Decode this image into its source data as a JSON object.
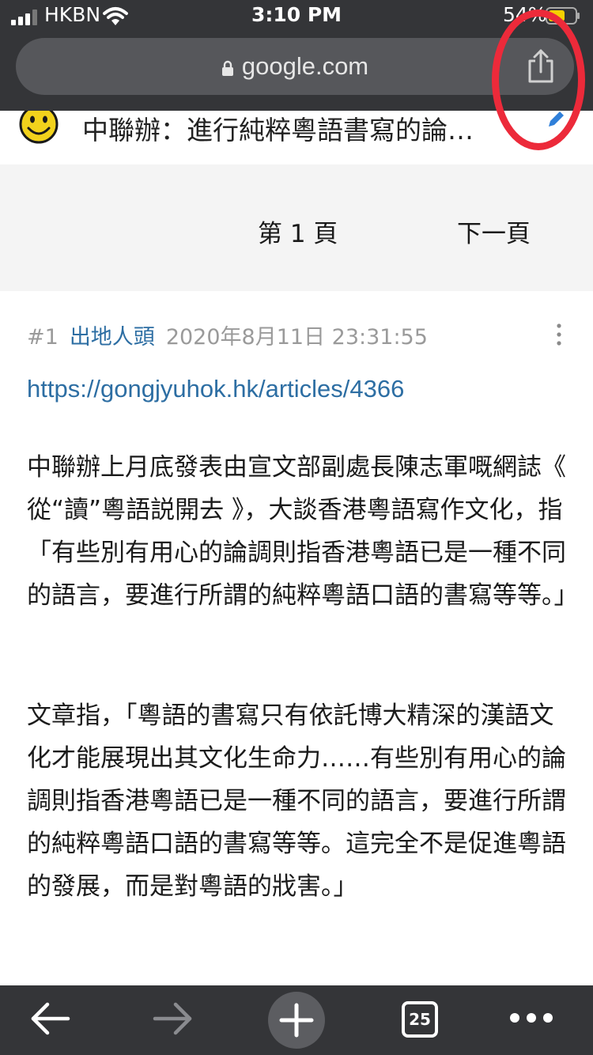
{
  "status_bar": {
    "carrier": "HKBN",
    "time": "3:10 PM",
    "battery_text": "54%"
  },
  "browser": {
    "url": "google.com",
    "icons": [
      "lock-icon",
      "share-icon"
    ]
  },
  "page": {
    "title": "中聯辦：進行純粹粵語書寫的論…"
  },
  "pagination": {
    "current": "第 1 頁",
    "next": "下一頁"
  },
  "post": {
    "number": "#1",
    "author": "出地人頭",
    "timestamp": "2020年8月11日 23:31:55",
    "link": "https://gongjyuhok.hk/articles/4366",
    "paragraphs": [
      "中聯辦上月底發表由宣文部副處長陳志軍嘅網誌《 從“讀”粵語説開去 》，大談香港粵語寫作文化，指「有些別有用心的論調則指香港粵語已是一種不同的語言，要進行所謂的純粹粵語口語的書寫等等。」",
      "文章指，「粵語的書寫只有依託博大精深的漢語文化才能展現出其文化生命力……有些別有用心的論調則指香港粵語已是一種不同的語言，要進行所謂的純粹粵語口語的書寫等等。這完全不是促進粵語的發展，而是對粵語的戕害。」"
    ]
  },
  "toolbar": {
    "tab_count": "25",
    "icons": [
      "back-arrow-icon",
      "forward-arrow-icon",
      "new-tab-plus-icon",
      "tabs-icon",
      "more-icon"
    ]
  },
  "colors": {
    "chrome": "#343538",
    "link": "#2d6ea3",
    "annotation": "#ec2a3a"
  }
}
